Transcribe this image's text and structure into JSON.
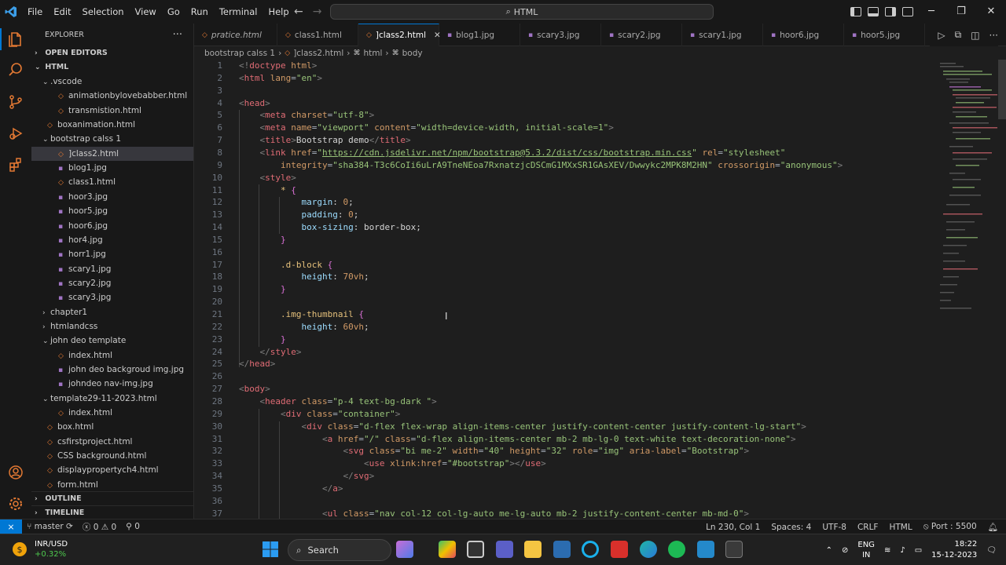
{
  "menu": [
    "File",
    "Edit",
    "Selection",
    "View",
    "Go",
    "Run",
    "Terminal",
    "Help"
  ],
  "command_center": "HTML",
  "explorer": {
    "title": "EXPLORER",
    "sections": {
      "open_editors": "OPEN EDITORS",
      "root": "HTML",
      "outline": "OUTLINE",
      "timeline": "TIMELINE"
    },
    "items": [
      {
        "label": ".vscode",
        "depth": 1,
        "type": "folder",
        "open": true
      },
      {
        "label": "animationbylovebabber.html",
        "depth": 2,
        "type": "html"
      },
      {
        "label": "transmistion.html",
        "depth": 2,
        "type": "html"
      },
      {
        "label": "boxanimation.html",
        "depth": 1,
        "type": "html"
      },
      {
        "label": "bootstrap calss 1",
        "depth": 1,
        "type": "folder",
        "open": true
      },
      {
        "label": "]class2.html",
        "depth": 2,
        "type": "html",
        "selected": true
      },
      {
        "label": "blog1.jpg",
        "depth": 2,
        "type": "img"
      },
      {
        "label": "class1.html",
        "depth": 2,
        "type": "html"
      },
      {
        "label": "hoor3.jpg",
        "depth": 2,
        "type": "img"
      },
      {
        "label": "hoor5.jpg",
        "depth": 2,
        "type": "img"
      },
      {
        "label": "hoor6.jpg",
        "depth": 2,
        "type": "img"
      },
      {
        "label": "hor4.jpg",
        "depth": 2,
        "type": "img"
      },
      {
        "label": "horr1.jpg",
        "depth": 2,
        "type": "img"
      },
      {
        "label": "scary1.jpg",
        "depth": 2,
        "type": "img"
      },
      {
        "label": "scary2.jpg",
        "depth": 2,
        "type": "img"
      },
      {
        "label": "scary3.jpg",
        "depth": 2,
        "type": "img"
      },
      {
        "label": "chapter1",
        "depth": 1,
        "type": "folder",
        "open": false
      },
      {
        "label": "htmlandcss",
        "depth": 1,
        "type": "folder",
        "open": false
      },
      {
        "label": "john deo template",
        "depth": 1,
        "type": "folder",
        "open": true
      },
      {
        "label": "index.html",
        "depth": 2,
        "type": "html"
      },
      {
        "label": "john deo backgroud img.jpg",
        "depth": 2,
        "type": "img"
      },
      {
        "label": "johndeo nav-img.jpg",
        "depth": 2,
        "type": "img"
      },
      {
        "label": "template29-11-2023.html",
        "depth": 1,
        "type": "folder",
        "open": true
      },
      {
        "label": "index.html",
        "depth": 2,
        "type": "html"
      },
      {
        "label": "box.html",
        "depth": 1,
        "type": "html"
      },
      {
        "label": "csfirstproject.html",
        "depth": 1,
        "type": "html"
      },
      {
        "label": "CSS background.html",
        "depth": 1,
        "type": "html"
      },
      {
        "label": "displaypropertych4.html",
        "depth": 1,
        "type": "html"
      },
      {
        "label": "form.html",
        "depth": 1,
        "type": "html"
      }
    ]
  },
  "tabs": [
    {
      "label": "pratice.html",
      "type": "html",
      "italic": true
    },
    {
      "label": "class1.html",
      "type": "html"
    },
    {
      "label": "]class2.html",
      "type": "html",
      "active": true
    },
    {
      "label": "blog1.jpg",
      "type": "img"
    },
    {
      "label": "scary3.jpg",
      "type": "img"
    },
    {
      "label": "scary2.jpg",
      "type": "img"
    },
    {
      "label": "scary1.jpg",
      "type": "img"
    },
    {
      "label": "hoor6.jpg",
      "type": "img"
    },
    {
      "label": "hoor5.jpg",
      "type": "img"
    }
  ],
  "breadcrumb": [
    "bootstrap calss 1",
    "]class2.html",
    "html",
    "body"
  ],
  "code_lines": [
    [
      [
        "t-br",
        "<!"
      ],
      [
        "tag",
        "doctype"
      ],
      [
        "attr",
        " html"
      ],
      [
        "t-br",
        ">"
      ]
    ],
    [
      [
        "t-br",
        "<"
      ],
      [
        "tag",
        "html"
      ],
      [
        "attr",
        " lang"
      ],
      [
        "punc",
        "="
      ],
      [
        "str",
        "\"en\""
      ],
      [
        "t-br",
        ">"
      ]
    ],
    [],
    [
      [
        "t-br",
        "<"
      ],
      [
        "tag",
        "head"
      ],
      [
        "t-br",
        ">"
      ]
    ],
    [
      [
        "val",
        "    "
      ],
      [
        "t-br",
        "<"
      ],
      [
        "tag",
        "meta"
      ],
      [
        "attr",
        " charset"
      ],
      [
        "punc",
        "="
      ],
      [
        "str",
        "\"utf-8\""
      ],
      [
        "t-br",
        ">"
      ]
    ],
    [
      [
        "val",
        "    "
      ],
      [
        "t-br",
        "<"
      ],
      [
        "tag",
        "meta"
      ],
      [
        "attr",
        " name"
      ],
      [
        "punc",
        "="
      ],
      [
        "str",
        "\"viewport\""
      ],
      [
        "attr",
        " content"
      ],
      [
        "punc",
        "="
      ],
      [
        "str",
        "\"width=device-width, initial-scale=1\""
      ],
      [
        "t-br",
        ">"
      ]
    ],
    [
      [
        "val",
        "    "
      ],
      [
        "t-br",
        "<"
      ],
      [
        "tag",
        "title"
      ],
      [
        "t-br",
        ">"
      ],
      [
        "val",
        "Bootstrap demo"
      ],
      [
        "t-br",
        "</"
      ],
      [
        "tag",
        "title"
      ],
      [
        "t-br",
        ">"
      ]
    ],
    [
      [
        "val",
        "    "
      ],
      [
        "t-br",
        "<"
      ],
      [
        "tag",
        "link"
      ],
      [
        "attr",
        " href"
      ],
      [
        "punc",
        "="
      ],
      [
        "str",
        "\""
      ],
      [
        "link",
        "https://cdn.jsdelivr.net/npm/bootstrap@5.3.2/dist/css/bootstrap.min.css"
      ],
      [
        "str",
        "\""
      ],
      [
        "attr",
        " rel"
      ],
      [
        "punc",
        "="
      ],
      [
        "str",
        "\"stylesheet\""
      ]
    ],
    [
      [
        "val",
        "        "
      ],
      [
        "attr",
        "integrity"
      ],
      [
        "punc",
        "="
      ],
      [
        "str",
        "\"sha384-T3c6CoIi6uLrA9TneNEoa7RxnatzjcDSCmG1MXxSR1GAsXEV/Dwwykc2MPK8M2HN\""
      ],
      [
        "attr",
        " crossorigin"
      ],
      [
        "punc",
        "="
      ],
      [
        "str",
        "\"anonymous\""
      ],
      [
        "t-br",
        ">"
      ]
    ],
    [
      [
        "val",
        "    "
      ],
      [
        "t-br",
        "<"
      ],
      [
        "tag",
        "style"
      ],
      [
        "t-br",
        ">"
      ]
    ],
    [
      [
        "val",
        "        "
      ],
      [
        "sel",
        "* "
      ],
      [
        "brk",
        "{"
      ]
    ],
    [
      [
        "val",
        "            "
      ],
      [
        "prop",
        "margin"
      ],
      [
        "val",
        ": "
      ],
      [
        "num",
        "0"
      ],
      [
        "val",
        ";"
      ]
    ],
    [
      [
        "val",
        "            "
      ],
      [
        "prop",
        "padding"
      ],
      [
        "val",
        ": "
      ],
      [
        "num",
        "0"
      ],
      [
        "val",
        ";"
      ]
    ],
    [
      [
        "val",
        "            "
      ],
      [
        "prop",
        "box-sizing"
      ],
      [
        "val",
        ": border-box;"
      ]
    ],
    [
      [
        "val",
        "        "
      ],
      [
        "brk",
        "}"
      ]
    ],
    [],
    [
      [
        "val",
        "        "
      ],
      [
        "sel",
        ".d-block "
      ],
      [
        "brk",
        "{"
      ]
    ],
    [
      [
        "val",
        "            "
      ],
      [
        "prop",
        "height"
      ],
      [
        "val",
        ": "
      ],
      [
        "num",
        "70vh"
      ],
      [
        "val",
        ";"
      ]
    ],
    [
      [
        "val",
        "        "
      ],
      [
        "brk",
        "}"
      ]
    ],
    [],
    [
      [
        "val",
        "        "
      ],
      [
        "sel",
        ".img-thumbnail "
      ],
      [
        "brk",
        "{"
      ]
    ],
    [
      [
        "val",
        "            "
      ],
      [
        "prop",
        "height"
      ],
      [
        "val",
        ": "
      ],
      [
        "num",
        "60vh"
      ],
      [
        "val",
        ";"
      ]
    ],
    [
      [
        "val",
        "        "
      ],
      [
        "brk",
        "}"
      ]
    ],
    [
      [
        "val",
        "    "
      ],
      [
        "t-br",
        "</"
      ],
      [
        "tag",
        "style"
      ],
      [
        "t-br",
        ">"
      ]
    ],
    [
      [
        "t-br",
        "</"
      ],
      [
        "tag",
        "head"
      ],
      [
        "t-br",
        ">"
      ]
    ],
    [],
    [
      [
        "t-br",
        "<"
      ],
      [
        "tag",
        "body"
      ],
      [
        "t-br",
        ">"
      ]
    ],
    [
      [
        "val",
        "    "
      ],
      [
        "t-br",
        "<"
      ],
      [
        "tag",
        "header"
      ],
      [
        "attr",
        " class"
      ],
      [
        "punc",
        "="
      ],
      [
        "str",
        "\"p-4 text-bg-dark \""
      ],
      [
        "t-br",
        ">"
      ]
    ],
    [
      [
        "val",
        "        "
      ],
      [
        "t-br",
        "<"
      ],
      [
        "tag",
        "div"
      ],
      [
        "attr",
        " class"
      ],
      [
        "punc",
        "="
      ],
      [
        "str",
        "\"container\""
      ],
      [
        "t-br",
        ">"
      ]
    ],
    [
      [
        "val",
        "            "
      ],
      [
        "t-br",
        "<"
      ],
      [
        "tag",
        "div"
      ],
      [
        "attr",
        " class"
      ],
      [
        "punc",
        "="
      ],
      [
        "str",
        "\"d-flex flex-wrap align-items-center justify-content-center justify-content-lg-start\""
      ],
      [
        "t-br",
        ">"
      ]
    ],
    [
      [
        "val",
        "                "
      ],
      [
        "t-br",
        "<"
      ],
      [
        "tag",
        "a"
      ],
      [
        "attr",
        " href"
      ],
      [
        "punc",
        "="
      ],
      [
        "str",
        "\"/\""
      ],
      [
        "attr",
        " class"
      ],
      [
        "punc",
        "="
      ],
      [
        "str",
        "\"d-flex align-items-center mb-2 mb-lg-0 text-white text-decoration-none\""
      ],
      [
        "t-br",
        ">"
      ]
    ],
    [
      [
        "val",
        "                    "
      ],
      [
        "t-br",
        "<"
      ],
      [
        "tag",
        "svg"
      ],
      [
        "attr",
        " class"
      ],
      [
        "punc",
        "="
      ],
      [
        "str",
        "\"bi me-2\""
      ],
      [
        "attr",
        " width"
      ],
      [
        "punc",
        "="
      ],
      [
        "str",
        "\"40\""
      ],
      [
        "attr",
        " height"
      ],
      [
        "punc",
        "="
      ],
      [
        "str",
        "\"32\""
      ],
      [
        "attr",
        " role"
      ],
      [
        "punc",
        "="
      ],
      [
        "str",
        "\"img\""
      ],
      [
        "attr",
        " aria-label"
      ],
      [
        "punc",
        "="
      ],
      [
        "str",
        "\"Bootstrap\""
      ],
      [
        "t-br",
        ">"
      ]
    ],
    [
      [
        "val",
        "                        "
      ],
      [
        "t-br",
        "<"
      ],
      [
        "tag",
        "use"
      ],
      [
        "attr",
        " xlink:href"
      ],
      [
        "punc",
        "="
      ],
      [
        "str",
        "\"#bootstrap\""
      ],
      [
        "t-br",
        "></"
      ],
      [
        "tag",
        "use"
      ],
      [
        "t-br",
        ">"
      ]
    ],
    [
      [
        "val",
        "                    "
      ],
      [
        "t-br",
        "</"
      ],
      [
        "tag",
        "svg"
      ],
      [
        "t-br",
        ">"
      ]
    ],
    [
      [
        "val",
        "                "
      ],
      [
        "t-br",
        "</"
      ],
      [
        "tag",
        "a"
      ],
      [
        "t-br",
        ">"
      ]
    ],
    [],
    [
      [
        "val",
        "                "
      ],
      [
        "t-br",
        "<"
      ],
      [
        "tag",
        "ul"
      ],
      [
        "attr",
        " class"
      ],
      [
        "punc",
        "="
      ],
      [
        "str",
        "\"nav col-12 col-lg-auto me-lg-auto mb-2 justify-content-center mb-md-0\""
      ],
      [
        "t-br",
        ">"
      ]
    ]
  ],
  "status": {
    "branch": "master",
    "errors": "0",
    "warnings": "0",
    "ports_count": "0",
    "position": "Ln 230, Col 1",
    "spaces": "Spaces: 4",
    "encoding": "UTF-8",
    "eol": "CRLF",
    "language": "HTML",
    "port": "Port : 5500"
  },
  "taskbar": {
    "ticker": "INR/USD",
    "change": "+0.32%",
    "search": "Search",
    "lang1": "ENG",
    "lang2": "IN",
    "time": "18:22",
    "date": "15-12-2023"
  }
}
